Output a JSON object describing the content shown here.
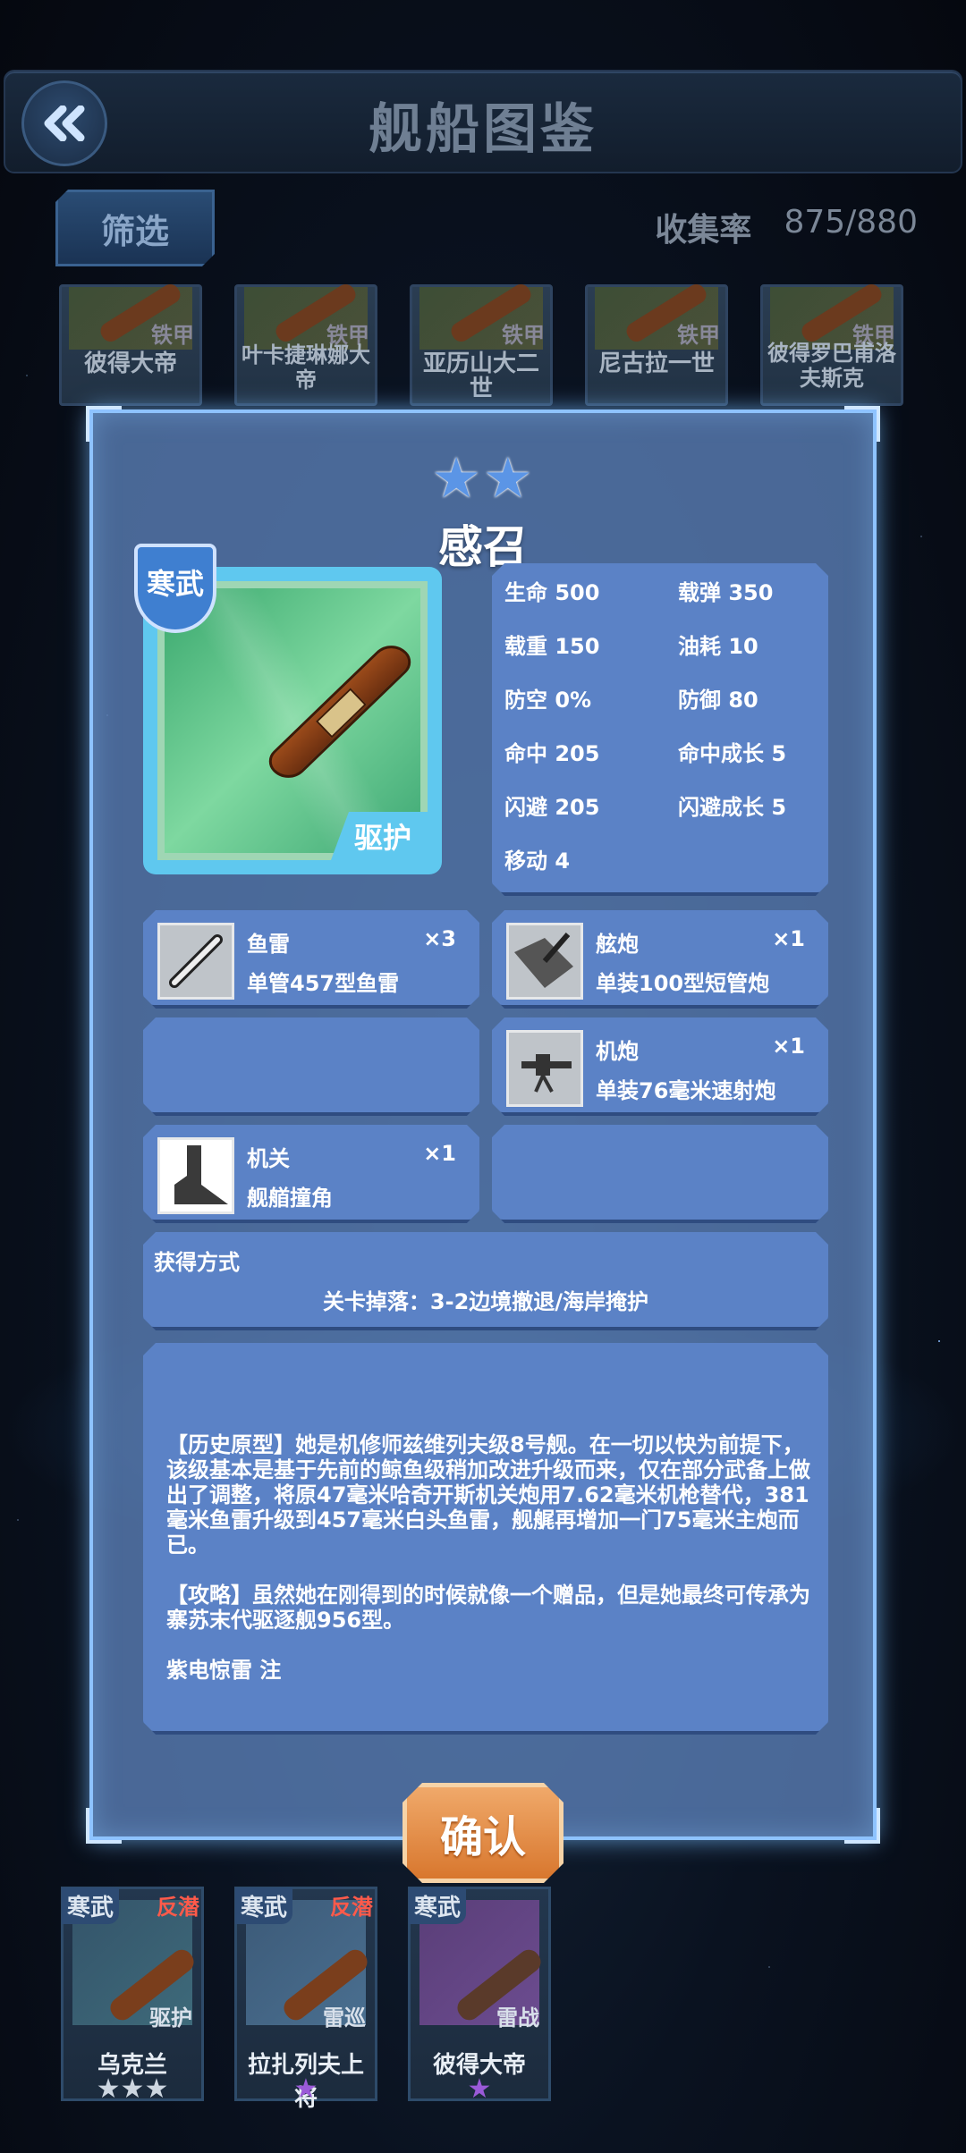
{
  "header": {
    "title": "舰船图鉴",
    "back_icon": "double-chevron-left-icon"
  },
  "toolbar": {
    "filter_label": "筛选",
    "collect_label": "收集率",
    "collect_value": "875/880"
  },
  "background_cards": [
    {
      "name": "彼得大帝",
      "type": "铁甲",
      "stars": "★★"
    },
    {
      "name": "叶卡捷琳娜大帝",
      "type": "铁甲",
      "stars": "★★"
    },
    {
      "name": "亚历山大二世",
      "type": "铁甲",
      "stars": "★★"
    },
    {
      "name": "尼古拉一世",
      "type": "铁甲",
      "stars": "★★"
    },
    {
      "name": "彼得罗巴甫洛夫斯克",
      "type": "铁甲",
      "stars": "★★"
    }
  ],
  "modal": {
    "stars": "★★",
    "ship_name": "感召",
    "faction": "寒武",
    "ship_type": "驱护",
    "stats": [
      "生命 500",
      "载弹 350",
      "载重 150",
      "油耗 10",
      "防空 0%",
      "防御 80",
      "命中 205",
      "命中成长 5",
      "闪避 205",
      "闪避成长 5",
      "移动 4"
    ],
    "equipment": [
      {
        "name": "鱼雷",
        "count": "×3",
        "desc": "单管457型鱼雷",
        "icon": "torpedo-icon"
      },
      {
        "name": "舷炮",
        "count": "×1",
        "desc": "单装100型短管炮",
        "icon": "deck-gun-icon"
      },
      {
        "name": "机炮",
        "count": "×1",
        "desc": "单装76毫米速射炮",
        "icon": "autocannon-icon"
      },
      {
        "name": "机关",
        "count": "×1",
        "desc": "舰艏撞角",
        "icon": "ram-bow-icon"
      }
    ],
    "acquisition_title": "获得方式",
    "acquisition_value": "关卡掉落：3-2边境撤退/海岸掩护",
    "description": [
      "【历史原型】她是机修师兹维列夫级8号舰。在一切以快为前提下，该级基本是基于先前的鲸鱼级稍加改进升级而来，仅在部分武备上做出了调整，将原47毫米哈奇开斯机关炮用7.62毫米机枪替代，381毫米鱼雷升级到457毫米白头鱼雷，舰艉再增加一门75毫米主炮而已。",
      "【攻略】虽然她在刚得到的时候就像一个赠品，但是她最终可传承为寨苏末代驱逐舰956型。",
      "紫电惊雷 注"
    ],
    "confirm_label": "确认"
  },
  "bottom_cards": [
    {
      "faction": "寒武",
      "tag": "反潜",
      "type": "驱护",
      "name": "乌克兰",
      "stars": "★★★"
    },
    {
      "faction": "寒武",
      "tag": "反潜",
      "type": "雷巡",
      "name": "拉扎列夫上将",
      "stars": "★"
    },
    {
      "faction": "寒武",
      "tag": "",
      "type": "雷战",
      "name": "彼得大帝",
      "stars": "★"
    }
  ],
  "colors": {
    "accent": "#5fc8ef",
    "panel": "#5b82c6",
    "confirm": "#e08a44",
    "danger": "#ff5a4a"
  }
}
